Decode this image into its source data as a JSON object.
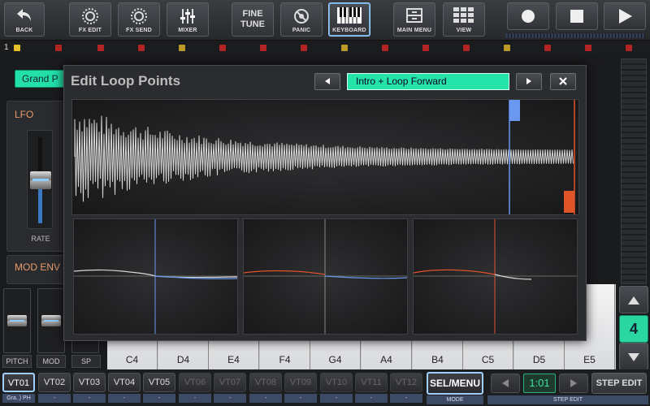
{
  "toolbar": {
    "back": "BACK",
    "fx_edit": "FX EDIT",
    "fx_send": "FX SEND",
    "mixer": "MIXER",
    "fine_tune_line1": "FINE",
    "fine_tune_line2": "TUNE",
    "panic": "PANIC",
    "keyboard": "KEYBOARD",
    "main_menu": "MAIN MENU",
    "view": "VIEW"
  },
  "track_strip": {
    "number": "1",
    "colors": {
      "active": "#e6c02a",
      "marker": "#b32424",
      "marker_alt": "#b89a2a"
    }
  },
  "background": {
    "preset": "Grand P",
    "lfo_label": "LFO",
    "lfo_rate_label": "RATE",
    "mod_env_label": "MOD ENV",
    "faders": [
      "PITCH",
      "MOD",
      "SP"
    ],
    "octave": "4"
  },
  "keyboard": {
    "keys": [
      "C4",
      "D4",
      "E4",
      "F4",
      "G4",
      "A4",
      "B4",
      "C5",
      "D5",
      "E5"
    ]
  },
  "bottom": {
    "tracks": [
      {
        "label": "VT01",
        "sub": "Gra..) PH",
        "state": "selected"
      },
      {
        "label": "VT02",
        "sub": "-",
        "state": "normal"
      },
      {
        "label": "VT03",
        "sub": "-",
        "state": "normal"
      },
      {
        "label": "VT04",
        "sub": "-",
        "state": "normal"
      },
      {
        "label": "VT05",
        "sub": "-",
        "state": "normal"
      },
      {
        "label": "VT06",
        "sub": "-",
        "state": "dim"
      },
      {
        "label": "VT07",
        "sub": "-",
        "state": "dim"
      },
      {
        "label": "VT08",
        "sub": "-",
        "state": "dim"
      },
      {
        "label": "VT09",
        "sub": "-",
        "state": "dim"
      },
      {
        "label": "VT10",
        "sub": "-",
        "state": "dim"
      },
      {
        "label": "VT11",
        "sub": "-",
        "state": "dim"
      },
      {
        "label": "VT12",
        "sub": "-",
        "state": "dim"
      }
    ],
    "sel_menu": "SEL/MENU",
    "mode_label": "MODE",
    "step_position": "1:01",
    "step_edit": "STEP EDIT",
    "step_edit_label": "STEP EDIT"
  },
  "dialog": {
    "title": "Edit Loop Points",
    "loop_mode": "Intro + Loop Forward",
    "colors": {
      "loop_start": "#6a98f0",
      "loop_end": "#e0542a",
      "accent": "#24e4aa"
    }
  }
}
